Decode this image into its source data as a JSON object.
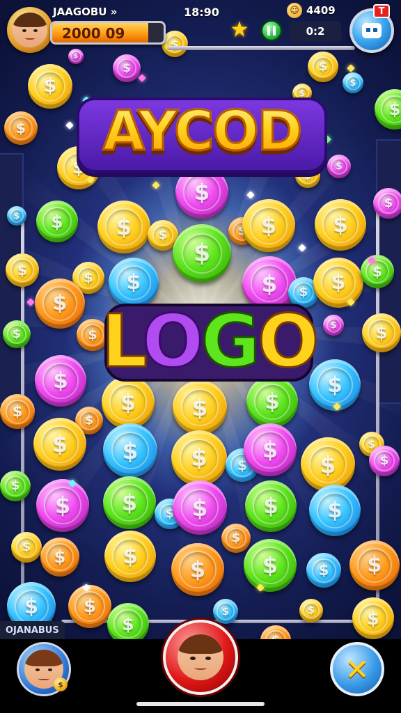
{
  "hud": {
    "player_name": "JAAGOBU »",
    "coin_balance": "2000 09",
    "coin_bar_fill": 0.86,
    "clock": "18:90",
    "status_value": "4409",
    "timer": "0:2",
    "menu_badge": "T",
    "icons": {
      "avatar": "player-avatar-icon",
      "star": "star-icon",
      "pause": "pause-icon",
      "menu": "game-menu-icon",
      "status": "emoji-coin-icon"
    }
  },
  "title": {
    "logo_text": "AYCOD",
    "center_letters": [
      "L",
      "O",
      "G",
      "O"
    ]
  },
  "bottom": {
    "corner_label": "OJANABUS",
    "left_avatar_badge": "$",
    "close_glyph": "✕",
    "icons": {
      "left": "player-profile-icon",
      "center": "play-avatar-icon",
      "right": "close-icon"
    }
  },
  "colors": {
    "gold": "#ffcf1f",
    "orange": "#ff9a1e",
    "green": "#5ee51e",
    "blue": "#36c3ff",
    "pink": "#f04cf0",
    "background": "#22307a"
  }
}
